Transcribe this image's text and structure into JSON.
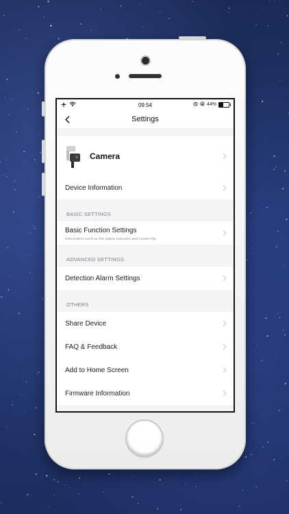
{
  "status_bar": {
    "time": "09:54",
    "battery": "44%",
    "battery_level": 0.44,
    "icons": [
      "airplane-icon",
      "wifi-icon",
      "alarm-icon",
      "orientation-lock-icon",
      "battery-icon"
    ]
  },
  "nav": {
    "title": "Settings",
    "back_icon": "chevron-left-icon"
  },
  "device": {
    "name": "Camera",
    "icon": "camera-device-icon"
  },
  "general_items": [
    {
      "label": "Device Information"
    }
  ],
  "sections": {
    "basic": {
      "header": "BASIC SETTINGS",
      "items": [
        {
          "label": "Basic Function Settings",
          "sublabel": "Information such as the status indicator and screen flip"
        }
      ]
    },
    "advanced": {
      "header": "ADVANCED SETTINGS",
      "items": [
        {
          "label": "Detection Alarm Settings"
        }
      ]
    },
    "others": {
      "header": "OTHERS",
      "items": [
        {
          "label": "Share Device"
        },
        {
          "label": "FAQ & Feedback"
        },
        {
          "label": "Add to Home Screen"
        },
        {
          "label": "Firmware Information"
        }
      ]
    }
  },
  "colors": {
    "screen_background": "#f4f4f6",
    "row_background": "#ffffff",
    "section_text": "#7d7d82",
    "chevron": "#c7c7cc"
  }
}
